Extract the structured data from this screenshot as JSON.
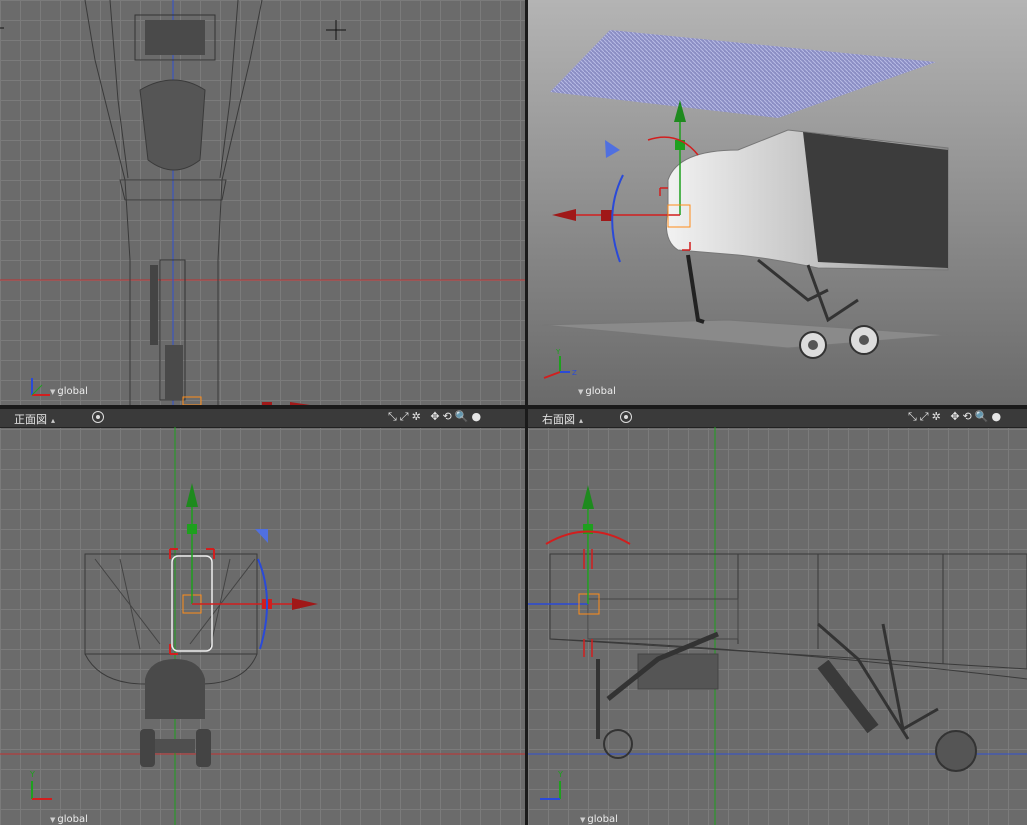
{
  "viewports": {
    "top": {
      "coord_label": "global"
    },
    "perspective": {
      "coord_label": "global"
    },
    "front": {
      "name": "正面図",
      "dropdown_glyph": "▴",
      "coord_label": "global",
      "tools": "⤡⤢✲ ✥⟲🔍●"
    },
    "right": {
      "name": "右面図",
      "dropdown_glyph": "▴",
      "coord_label": "global",
      "tools": "⤡⤢✲ ✥⟲🔍●"
    }
  },
  "axis_labels": {
    "x": "X",
    "y": "Y",
    "z": "Z"
  },
  "colors": {
    "viewport_bg": "#6b6b6b",
    "grid": "#7b7b7b",
    "x_axis": "#d21e1e",
    "y_axis": "#1ea01e",
    "z_axis": "#2a4ad8",
    "selection": "#ff8c1a"
  }
}
